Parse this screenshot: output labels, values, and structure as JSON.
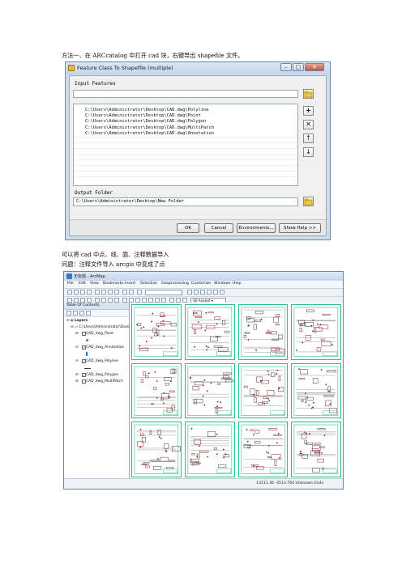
{
  "doc": {
    "method_line": "方法一、在 ARCcatalog 中打开 cad 块，右键导出 shapefile 文件。",
    "line2": "可以将 cad 中点、线、面、注释数据导入",
    "line3": "问题：注释文件导入 arcgis 中变成了点"
  },
  "dialog": {
    "title": "Feature Class To Shapefile (multiple)",
    "window_buttons": {
      "minimize": "–",
      "maximize": "□",
      "close": "✕"
    },
    "input_label": "Input Features",
    "input_value": "",
    "input_items": [
      "C:\\Users\\Administrator\\Desktop\\CAD.dwg\\Polyline",
      "C:\\Users\\Administrator\\Desktop\\CAD.dwg\\Point",
      "C:\\Users\\Administrator\\Desktop\\CAD.dwg\\Polygon",
      "C:\\Users\\Administrator\\Desktop\\CAD.dwg\\MultiPatch",
      "C:\\Users\\Administrator\\Desktop\\CAD.dwg\\Annotation"
    ],
    "side_buttons": {
      "add": "+",
      "remove": "✕",
      "up": "↑",
      "down": "↓"
    },
    "output_label": "Output Folder",
    "output_value": "C:\\Users\\Administrator\\Desktop\\New Folder",
    "buttons": {
      "ok": "OK",
      "cancel": "Cancel",
      "environments": "Environments...",
      "show_help": "Show Help >>"
    }
  },
  "arcmap": {
    "title": "无标题 - ArcMap",
    "menus": [
      "File",
      "Edit",
      "View",
      "Bookmarks",
      "Insert",
      "Selection",
      "Geoprocessing",
      "Customize",
      "Windows",
      "Help"
    ],
    "toolbar_dropdown": "3D Analyst ▾",
    "toc_title": "Table Of Contents",
    "layers_label": "Layers",
    "dwg_path": "C:\\Users\\Administrator\\Deskt",
    "layers": [
      {
        "name": "CAD_dwg_Point",
        "checked": false
      },
      {
        "name": "CAD_dwg_Annotation",
        "checked": true
      },
      {
        "name": "CAD_dwg_Polyline",
        "checked": true
      },
      {
        "name": "CAD_dwg_Polygon",
        "checked": true
      },
      {
        "name": "CAD_dwg_MultiPatch",
        "checked": false
      }
    ],
    "status": "13111.36  -3513.794 Unknown Units"
  }
}
